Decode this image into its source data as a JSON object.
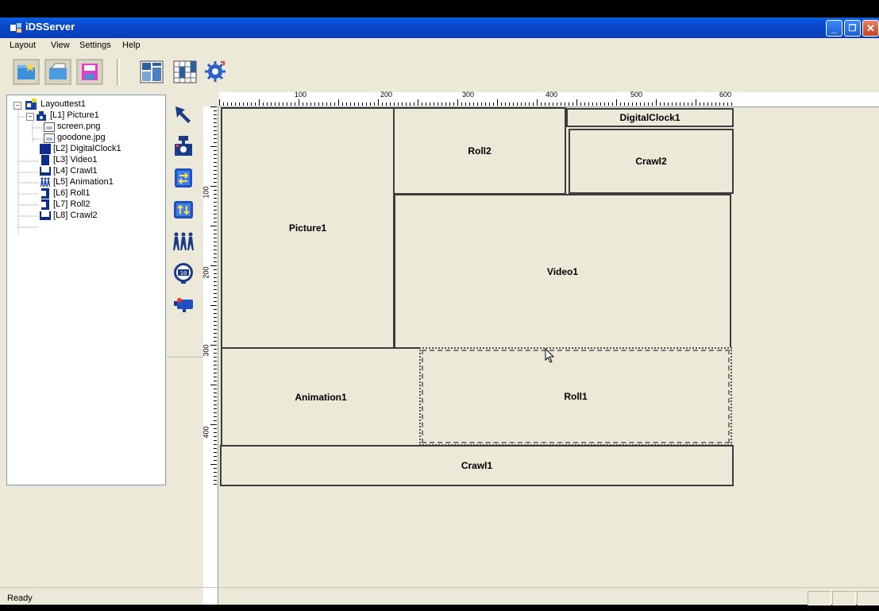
{
  "window": {
    "title": "iDSServer"
  },
  "caption_buttons": {
    "minimize": "_",
    "restore": "❐",
    "close": "✕"
  },
  "menu": [
    "Layout",
    "View",
    "Settings",
    "Help"
  ],
  "toolbar": {
    "buttons": [
      "new-layout-icon",
      "open-folder-icon",
      "save-disk-icon",
      "layout-properties-icon",
      "schedule-grid-icon",
      "settings-gear-icon"
    ]
  },
  "tree": {
    "root": "Layouttest1",
    "items": [
      {
        "label": "[L1] Picture1",
        "icon": "picture-camera-icon"
      },
      {
        "label": "screen.png",
        "icon": "image-file-icon"
      },
      {
        "label": "goodone.jpg",
        "icon": "image-file-icon"
      },
      {
        "label": "[L2] DigitalClock1",
        "icon": "clock-block-icon"
      },
      {
        "label": "[L3] Video1",
        "icon": "video-block-icon"
      },
      {
        "label": "[L4] Crawl1",
        "icon": "crawl-block-icon"
      },
      {
        "label": "[L5] Animation1",
        "icon": "animation-people-icon"
      },
      {
        "label": "[L6] Roll1",
        "icon": "roll-block-icon"
      },
      {
        "label": "[L7] Roll2",
        "icon": "roll-block-icon"
      },
      {
        "label": "[L8] Crawl2",
        "icon": "crawl-block-icon"
      }
    ]
  },
  "tools": [
    "select-arrow-icon",
    "picture-camera-icon",
    "crawl-scroll-icon",
    "roll-scroll-icon",
    "animation-people-icon",
    "digital-clock-icon",
    "video-camera-icon"
  ],
  "ruler": {
    "top_labels": [
      "100",
      "200",
      "300",
      "400",
      "500",
      "600"
    ],
    "left_labels": [
      "100",
      "200",
      "300",
      "400"
    ]
  },
  "regions": {
    "picture1": "Picture1",
    "roll2": "Roll2",
    "digitalclock1": "DigitalClock1",
    "crawl2": "Crawl2",
    "video1": "Video1",
    "animation1": "Animation1",
    "roll1": "Roll1",
    "crawl1": "Crawl1"
  },
  "status": {
    "text": "Ready"
  },
  "colors": {
    "title_bar": "#0A5EE0",
    "face": "#ECE9D8",
    "region_border": "#3C3C3C"
  }
}
